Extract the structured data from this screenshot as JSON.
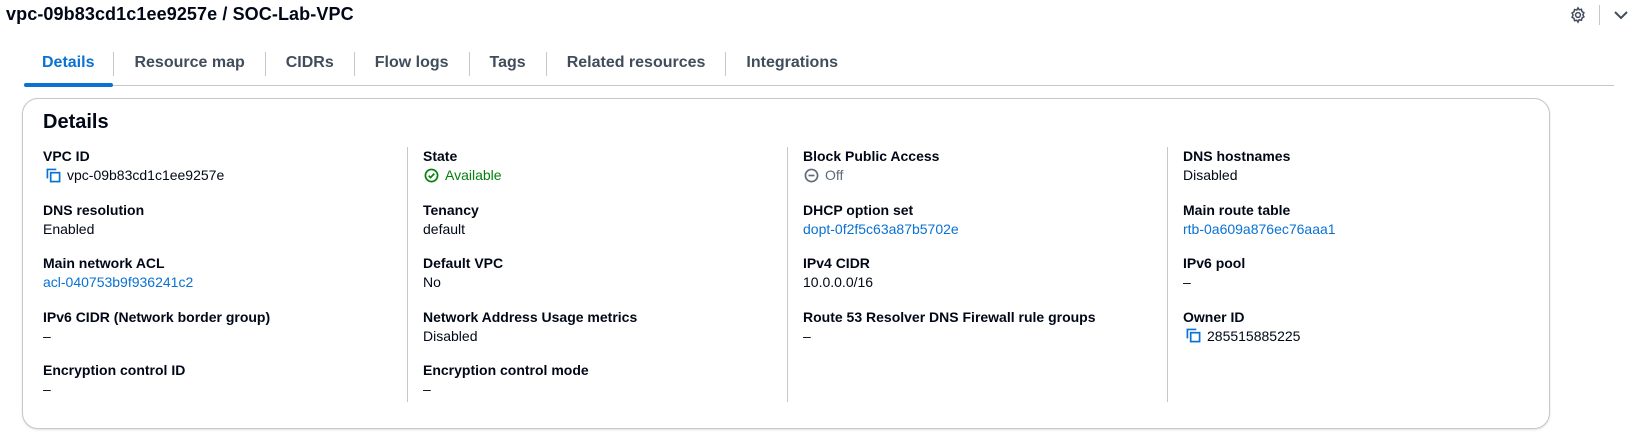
{
  "header": {
    "title": "vpc-09b83cd1c1ee9257e / SOC-Lab-VPC",
    "settings_icon": "gear-icon",
    "collapse_icon": "chevron-down-icon"
  },
  "tabs": [
    {
      "label": "Details",
      "active": true
    },
    {
      "label": "Resource map"
    },
    {
      "label": "CIDRs"
    },
    {
      "label": "Flow logs"
    },
    {
      "label": "Tags"
    },
    {
      "label": "Related resources"
    },
    {
      "label": "Integrations"
    }
  ],
  "details": {
    "title": "Details",
    "col1": [
      {
        "label": "VPC ID",
        "value": "vpc-09b83cd1c1ee9257e"
      },
      {
        "label": "DNS resolution",
        "value": "Enabled"
      },
      {
        "label": "Main network ACL",
        "value": "acl-040753b9f936241c2"
      },
      {
        "label": "IPv6 CIDR (Network border group)",
        "value": "–"
      },
      {
        "label": "Encryption control ID",
        "value": "–"
      }
    ],
    "col2": [
      {
        "label": "State",
        "value": "Available"
      },
      {
        "label": "Tenancy",
        "value": "default"
      },
      {
        "label": "Default VPC",
        "value": "No"
      },
      {
        "label": "Network Address Usage metrics",
        "value": "Disabled"
      },
      {
        "label": "Encryption control mode",
        "value": "–"
      }
    ],
    "col3": [
      {
        "label": "Block Public Access",
        "value": "Off"
      },
      {
        "label": "DHCP option set",
        "value": "dopt-0f2f5c63a87b5702e"
      },
      {
        "label": "IPv4 CIDR",
        "value": "10.0.0.0/16"
      },
      {
        "label": "Route 53 Resolver DNS Firewall rule groups",
        "value": "–"
      }
    ],
    "col4": [
      {
        "label": "DNS hostnames",
        "value": "Disabled"
      },
      {
        "label": "Main route table",
        "value": "rtb-0a609a876ec76aaa1"
      },
      {
        "label": "IPv6 pool",
        "value": "–"
      },
      {
        "label": "Owner ID",
        "value": "285515885225"
      }
    ]
  },
  "colors": {
    "link": "#0972d3",
    "success": "#037f0c",
    "muted": "#5f6b7a",
    "border": "#c6c6cd"
  }
}
